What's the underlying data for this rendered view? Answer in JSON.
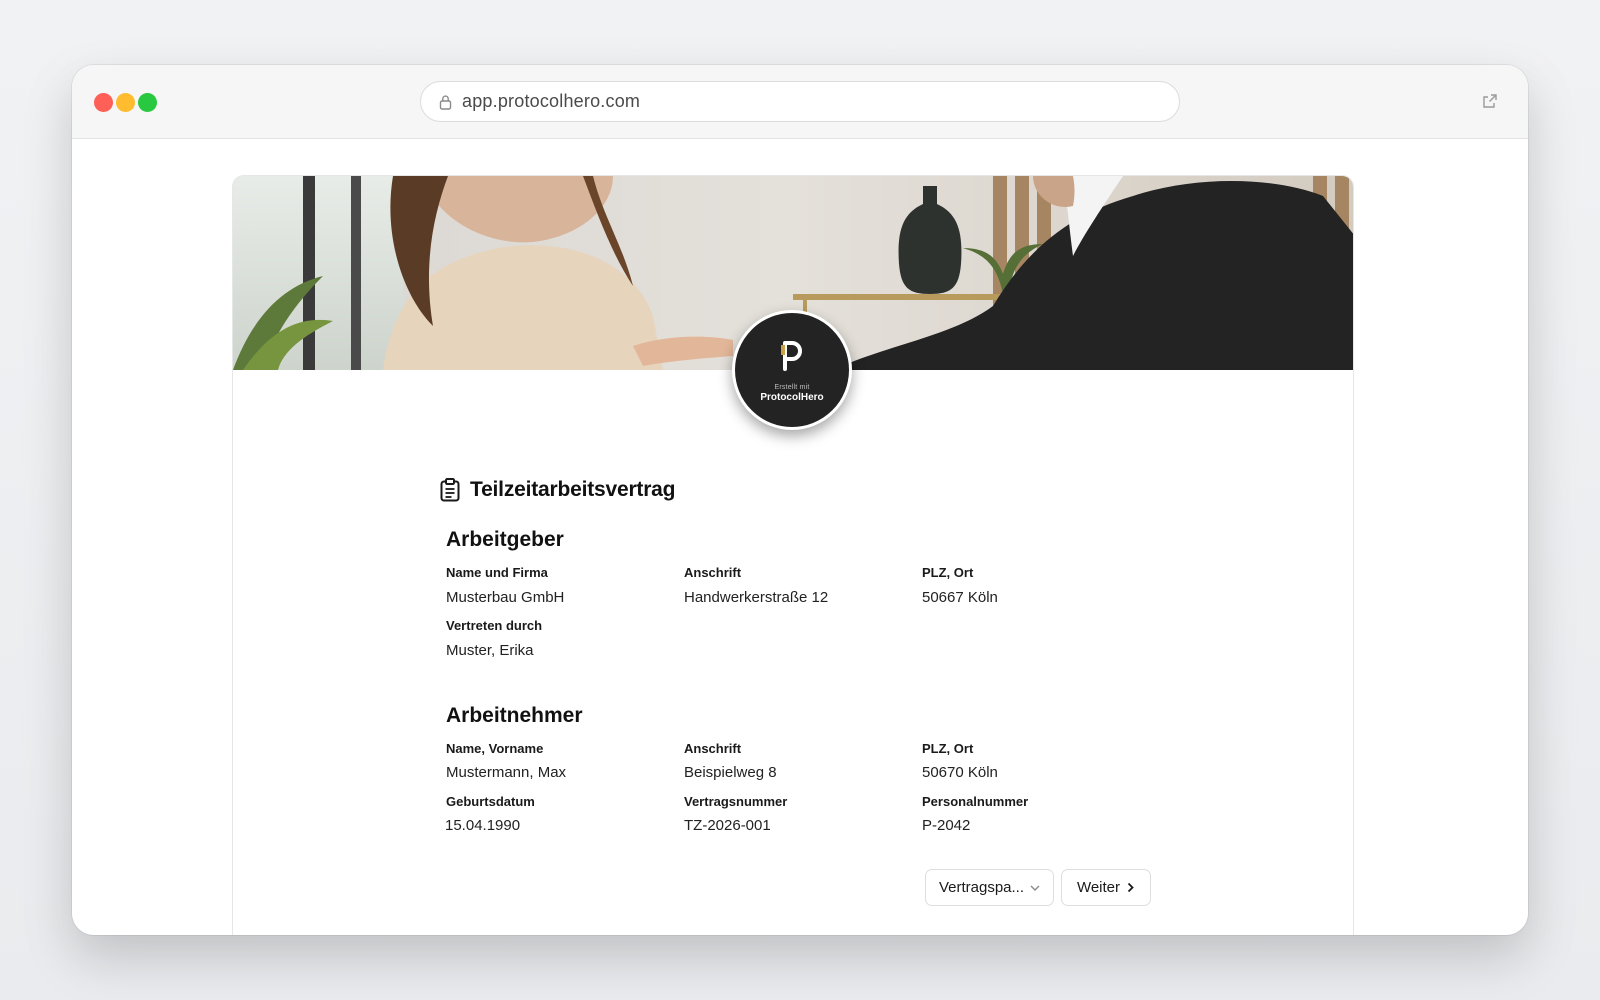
{
  "browser": {
    "url": "app.protocolhero.com",
    "icons": {
      "lock": "lock-icon",
      "external": "external-link-icon"
    }
  },
  "logo": {
    "small_text": "Erstellt mit",
    "name": "ProtocolHero"
  },
  "document": {
    "title": "Teilzeitarbeitsvertrag",
    "icon": "clipboard-icon"
  },
  "employer": {
    "heading": "Arbeitgeber",
    "fields": [
      {
        "label": "Name und Firma",
        "value": "Musterbau GmbH"
      },
      {
        "label": "Anschrift",
        "value": "Handwerkerstraße 12"
      },
      {
        "label": "PLZ, Ort",
        "value": "50667 Köln"
      },
      {
        "label": "Vertreten durch",
        "value": "Muster, Erika"
      }
    ]
  },
  "employee": {
    "heading": "Arbeitnehmer",
    "fields": [
      {
        "label": "Name, Vorname",
        "value": "Mustermann, Max"
      },
      {
        "label": "Anschrift",
        "value": "Beispielweg 8"
      },
      {
        "label": "PLZ, Ort",
        "value": "50670 Köln"
      },
      {
        "label": "Geburtsdatum",
        "value": "15.04.1990"
      },
      {
        "label": "Vertragsnummer",
        "value": "TZ-2026-001"
      },
      {
        "label": "Personalnummer",
        "value": "P-2042"
      }
    ]
  },
  "actions": {
    "dropdown_label": "Vertragspa...",
    "next_label": "Weiter"
  },
  "colors": {
    "badge_bg": "#232323",
    "traffic_red": "#fe5f57",
    "traffic_yellow": "#febc2e",
    "traffic_green": "#28c840"
  }
}
